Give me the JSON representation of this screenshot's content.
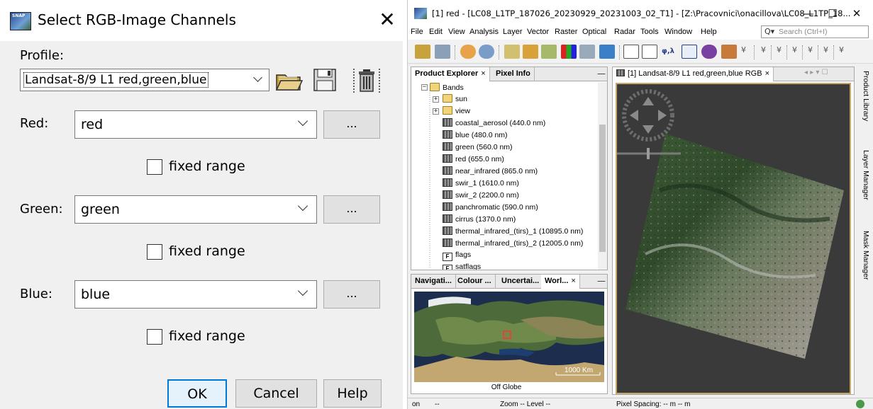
{
  "dialog": {
    "title": "Select RGB-Image Channels",
    "close_glyph": "✕",
    "profile_label": "Profile:",
    "profile_value": "Landsat-8/9 L1 red,green,blue",
    "icons": [
      "open-folder-icon",
      "save-icon",
      "delete-icon"
    ],
    "channels": [
      {
        "label": "Red:",
        "value": "red",
        "fixed_range_label": "fixed range",
        "fixed_range_checked": false,
        "more_label": "..."
      },
      {
        "label": "Green:",
        "value": "green",
        "fixed_range_label": "fixed range",
        "fixed_range_checked": false,
        "more_label": "..."
      },
      {
        "label": "Blue:",
        "value": "blue",
        "fixed_range_label": "fixed range",
        "fixed_range_checked": false,
        "more_label": "..."
      }
    ],
    "buttons": {
      "ok": "OK",
      "cancel": "Cancel",
      "help": "Help"
    }
  },
  "snap": {
    "title": "[1] red - [LC08_L1TP_187026_20230929_20231003_02_T1] - [Z:\\Pracovnici\\onacillova\\LC08_L1TP_18...",
    "window_controls": {
      "minimize": "—",
      "maximize": "☐",
      "close": "✕"
    },
    "menu": [
      "File",
      "Edit",
      "View",
      "Analysis",
      "Layer",
      "Vector",
      "Raster",
      "Optical",
      "Radar",
      "Tools",
      "Window",
      "Help"
    ],
    "search_placeholder": "Search (Ctrl+I)",
    "toolbar_text": "φ,λ",
    "product_explorer": {
      "tabs": [
        "Product Explorer",
        "Pixel Info"
      ],
      "tab_close": "×",
      "minimize": "—",
      "root": "Bands",
      "folders": [
        "sun",
        "view"
      ],
      "bands": [
        "coastal_aerosol (440.0 nm)",
        "blue (480.0 nm)",
        "green (560.0 nm)",
        "red (655.0 nm)",
        "near_infrared (865.0 nm)",
        "swir_1 (1610.0 nm)",
        "swir_2 (2200.0 nm)",
        "panchromatic (590.0 nm)",
        "cirrus (1370.0 nm)",
        "thermal_infrared_(tirs)_1 (10895.0 nm)",
        "thermal_infrared_(tirs)_2 (12005.0 nm)"
      ],
      "flags": [
        "flags",
        "satflags"
      ],
      "flag_glyph": "F"
    },
    "nav_panel": {
      "tabs": [
        "Navigati...",
        "Colour ...",
        "Uncertai...",
        "Worl..."
      ],
      "tab_close": "×",
      "minimize": "—",
      "scale_label": "1000 Km",
      "footer": "Off Globe"
    },
    "image_view": {
      "tab": "[1] Landsat-8/9 L1 red,green,blue RGB",
      "tab_close": "×",
      "controls": "◂ ▸ ▾ ☐"
    },
    "side_tabs": [
      "Product Library",
      "Layer Manager",
      "Mask Manager"
    ],
    "status": {
      "left": "on",
      "left2": "--",
      "zoom": "Zoom -- Level --",
      "spacing": "Pixel Spacing: -- m -- m"
    }
  }
}
